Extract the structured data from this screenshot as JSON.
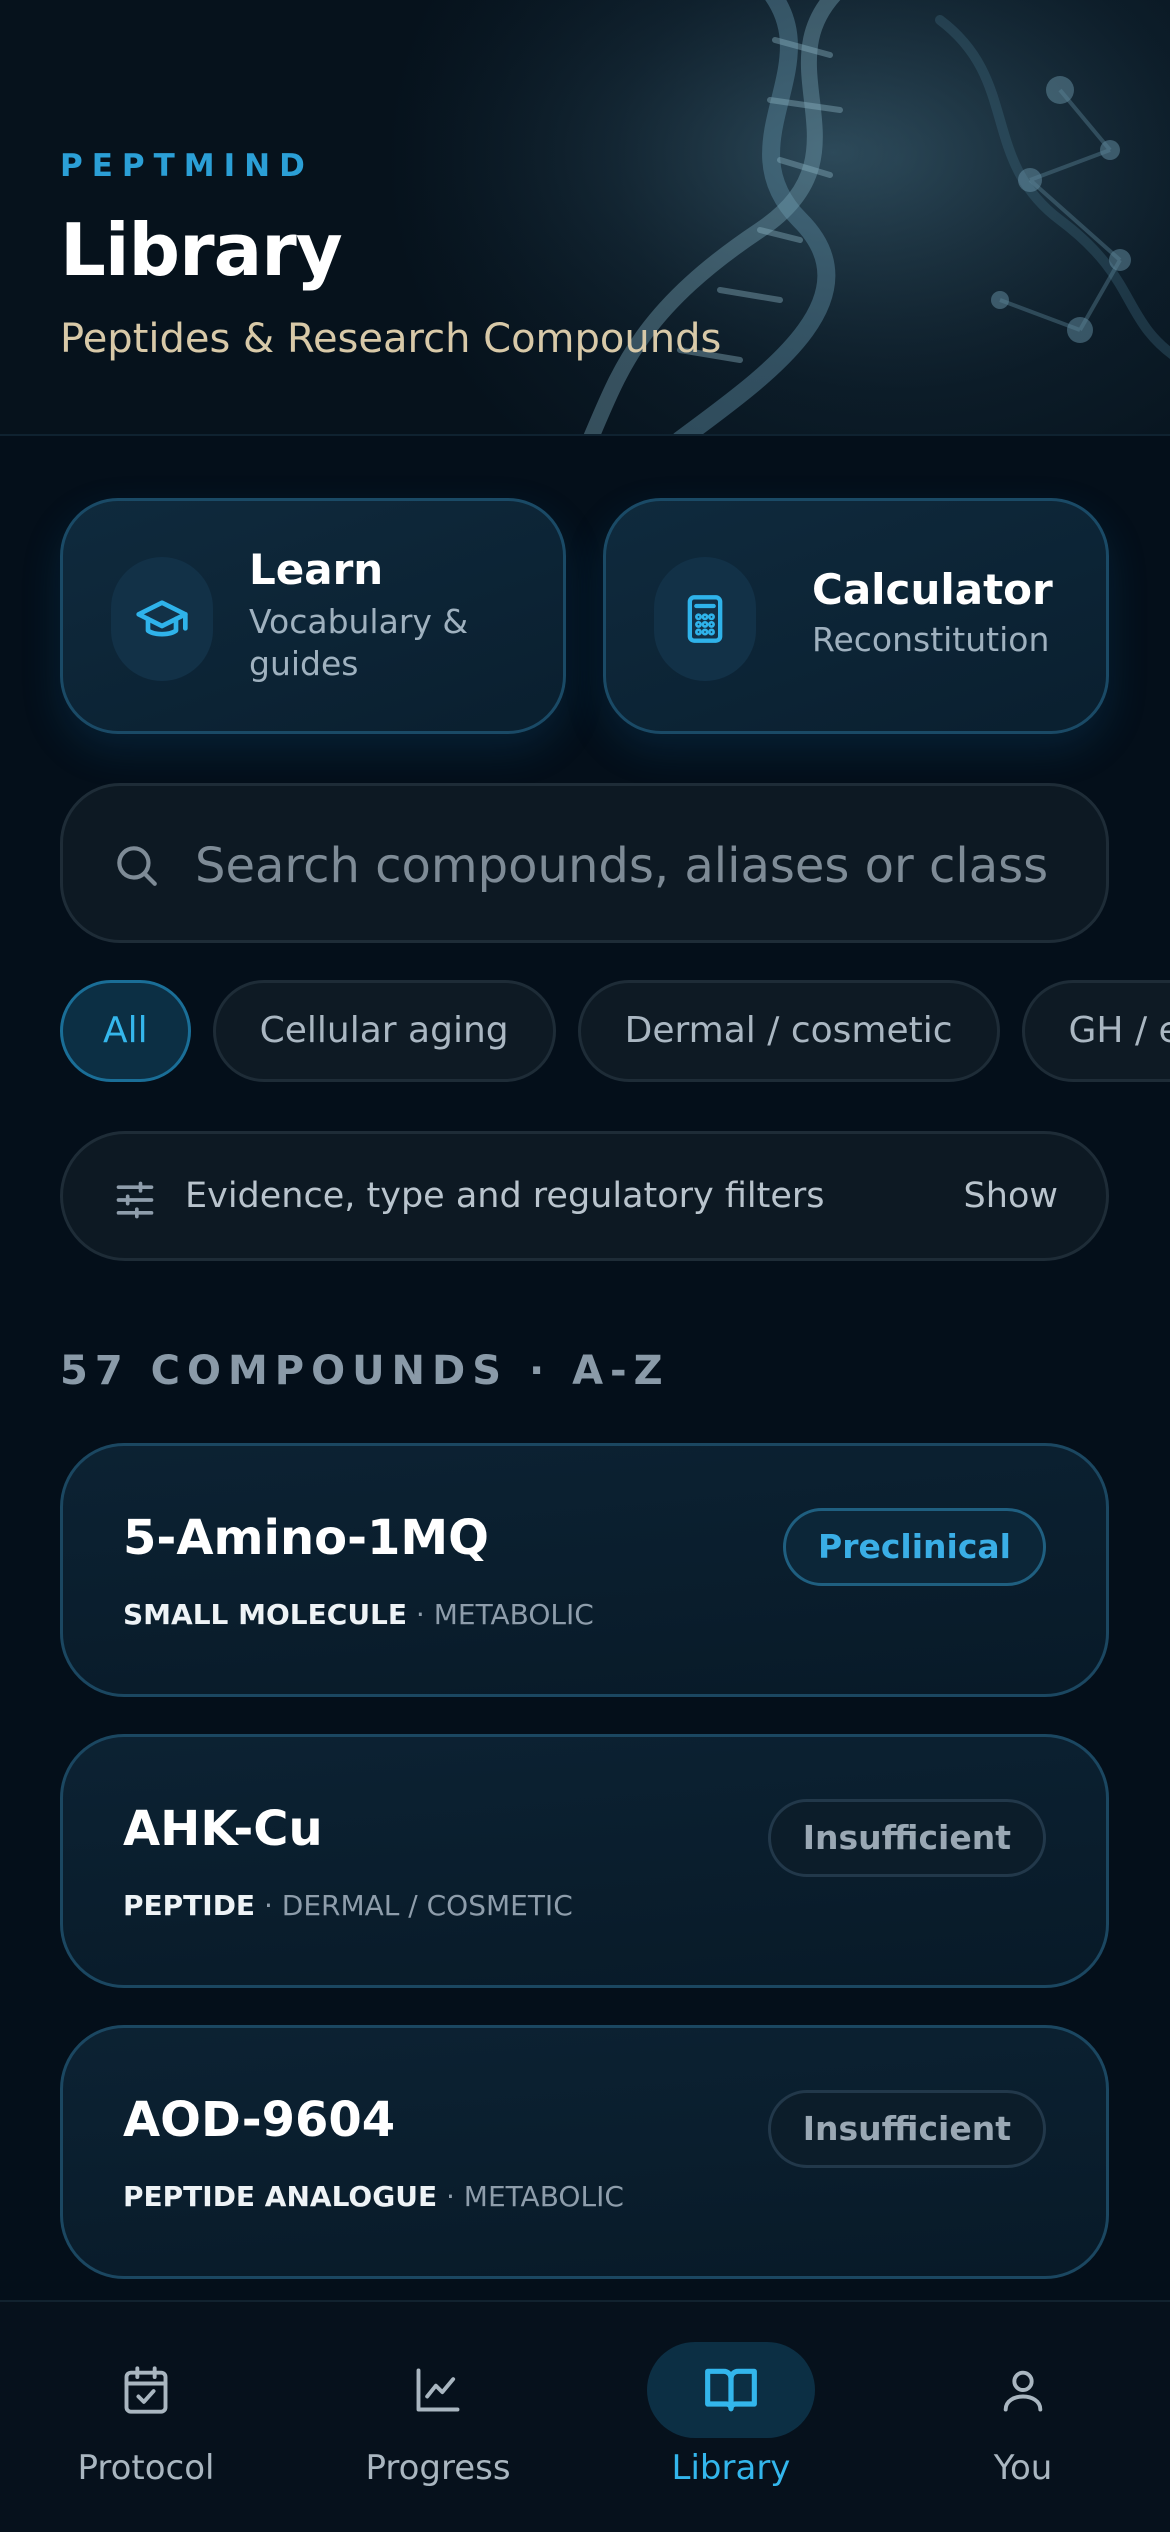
{
  "header": {
    "brand": "PEPTMIND",
    "title": "Library",
    "subtitle": "Peptides & Research Compounds"
  },
  "quick_actions": [
    {
      "title": "Learn",
      "subtitle": "Vocabulary & guides",
      "icon": "graduation-cap-icon"
    },
    {
      "title": "Calculator",
      "subtitle": "Reconstitution",
      "icon": "calculator-icon"
    }
  ],
  "search": {
    "placeholder": "Search compounds, aliases or class",
    "value": ""
  },
  "chips": [
    {
      "label": "All",
      "active": true
    },
    {
      "label": "Cellular aging",
      "active": false
    },
    {
      "label": "Dermal / cosmetic",
      "active": false
    },
    {
      "label": "GH / endocrine",
      "active": false
    }
  ],
  "filters": {
    "label": "Evidence, type and regulatory filters",
    "toggle": "Show"
  },
  "list": {
    "count_label": "57 COMPOUNDS · A-Z",
    "items": [
      {
        "name": "5-Amino-1MQ",
        "type": "SMALL MOLECULE",
        "class": "METABOLIC",
        "evidence": "Preclinical"
      },
      {
        "name": "AHK-Cu",
        "type": "PEPTIDE",
        "class": "DERMAL / COSMETIC",
        "evidence": "Insufficient"
      },
      {
        "name": "AOD-9604",
        "type": "PEPTIDE ANALOGUE",
        "class": "METABOLIC",
        "evidence": "Insufficient"
      }
    ]
  },
  "nav": {
    "items": [
      {
        "label": "Protocol",
        "icon": "calendar-check-icon",
        "active": false
      },
      {
        "label": "Progress",
        "icon": "line-chart-icon",
        "active": false
      },
      {
        "label": "Library",
        "icon": "open-book-icon",
        "active": true
      },
      {
        "label": "You",
        "icon": "user-icon",
        "active": false
      }
    ]
  },
  "colors": {
    "accent": "#33b6ec",
    "brand": "#2b9fd6",
    "background": "#040f1a",
    "subtitle": "#d8c9a8"
  }
}
